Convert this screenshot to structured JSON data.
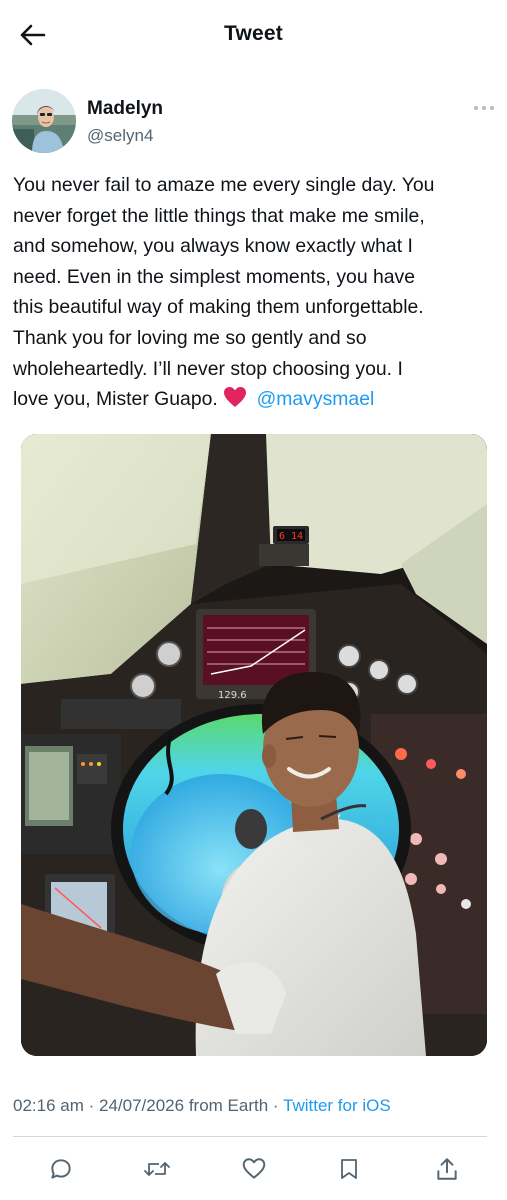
{
  "header": {
    "title": "Tweet",
    "back_icon": "arrow-left-icon"
  },
  "author": {
    "name": "Madelyn",
    "handle": "@selyn4",
    "more_icon": "more-horizontal-icon"
  },
  "tweet": {
    "text": "You never fail to amaze me every single day. You\nnever forget the little things that make me smile,\nand somehow, you always know exactly what I\nneed. Even in the simplest moments, you have\nthis beautiful way of making them unforgettable.\nThank you for loving me so gently and so\nwholeheartedly. I’ll never stop choosing you. I\nlove you, Mister Guapo. ",
    "emoji": "red-heart-emoji",
    "mention": "@mavysmael"
  },
  "media": {
    "display_readout": "6 14",
    "screen_value": "129.6"
  },
  "meta": {
    "time": "02:16 am",
    "separator1": " · ",
    "date": "24/07/2026",
    "location": " from Earth",
    "separator2": " · ",
    "client": "Twitter for iOS"
  },
  "actions": [
    {
      "icon": "reply-icon"
    },
    {
      "icon": "retweet-icon"
    },
    {
      "icon": "like-icon"
    },
    {
      "icon": "bookmark-icon"
    },
    {
      "icon": "share-icon"
    }
  ],
  "colors": {
    "link": "#1d9bf0",
    "secondary_text": "#536471",
    "primary_text": "#0f1419",
    "divider": "#cfd9de",
    "heart": "#e0245e"
  }
}
